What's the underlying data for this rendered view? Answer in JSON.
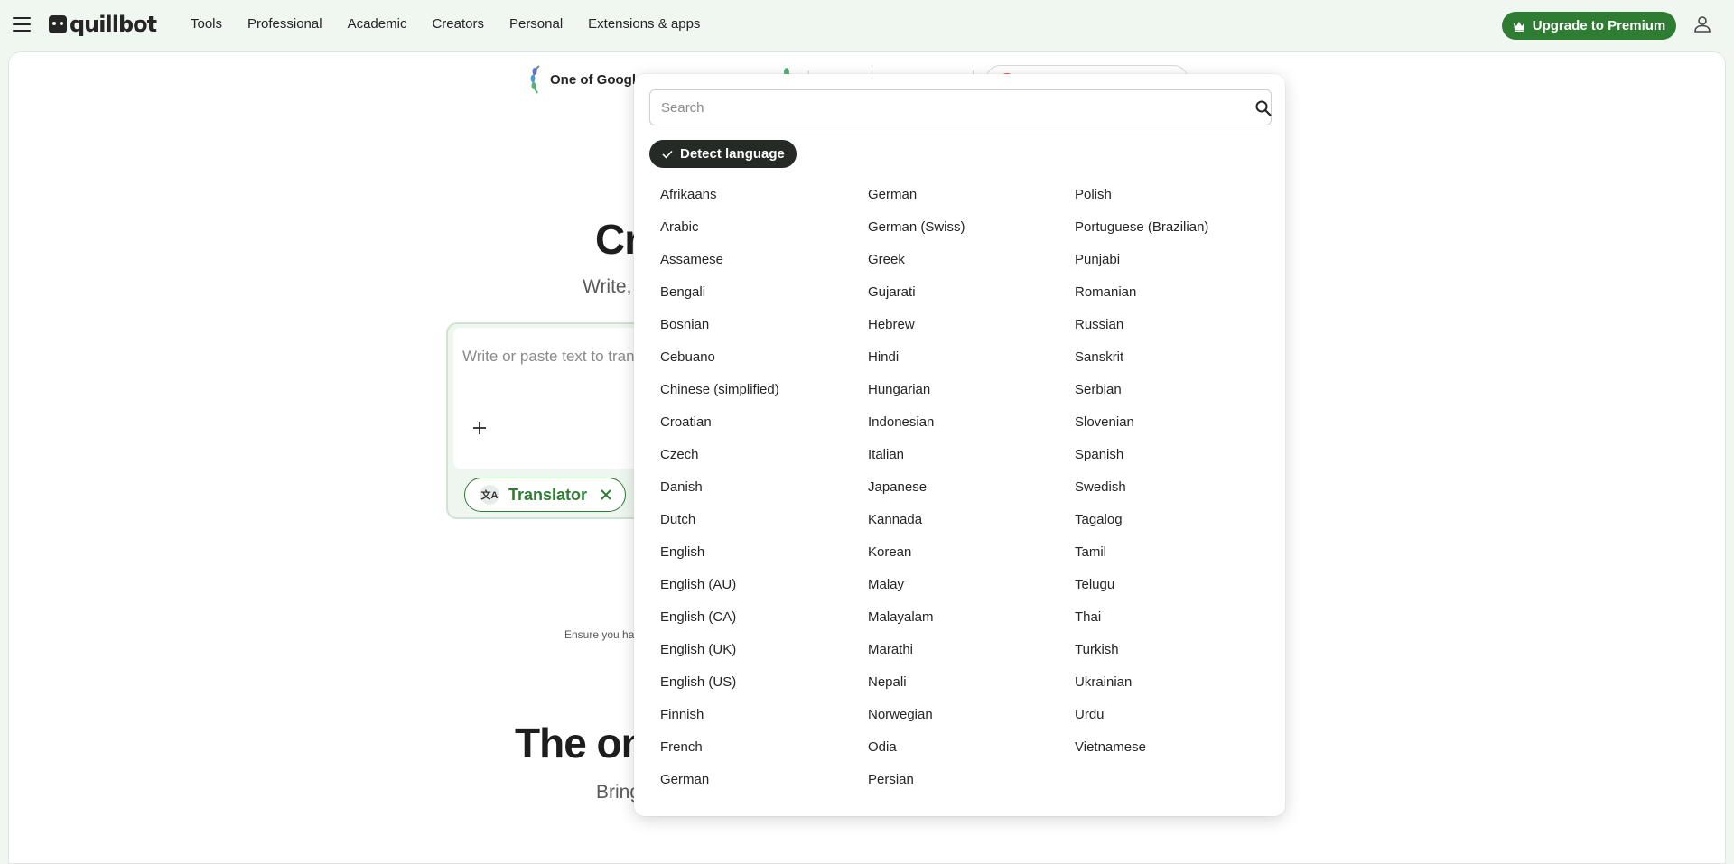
{
  "nav": {
    "logo_text": "quillbot",
    "links": [
      "Tools",
      "Professional",
      "Academic",
      "Creators",
      "Personal",
      "Extensions & apps"
    ],
    "upgrade_label": "Upgrade to Premium",
    "accent_color": "#2e7d32"
  },
  "hero": {
    "award_text": "One of Googl",
    "title": "Cr",
    "subtitle": "Write,",
    "placeholder": "Write or paste text to tran",
    "translator_label": "Translator",
    "translate_icon_text": "文A",
    "ensure_text": "Ensure you ha",
    "big_title": "The onl",
    "bring_text": "Bring"
  },
  "dropdown": {
    "search_placeholder": "Search",
    "detect_label": "Detect language",
    "columns": [
      [
        "Afrikaans",
        "Arabic",
        "Assamese",
        "Bengali",
        "Bosnian",
        "Cebuano",
        "Chinese (simplified)",
        "Croatian",
        "Czech",
        "Danish",
        "Dutch",
        "English",
        "English (AU)",
        "English (CA)",
        "English (UK)",
        "English (US)",
        "Finnish",
        "French",
        "German"
      ],
      [
        "German",
        "German (Swiss)",
        "Greek",
        "Gujarati",
        "Hebrew",
        "Hindi",
        "Hungarian",
        "Indonesian",
        "Italian",
        "Japanese",
        "Kannada",
        "Korean",
        "Malay",
        "Malayalam",
        "Marathi",
        "Nepali",
        "Norwegian",
        "Odia",
        "Persian"
      ],
      [
        "Polish",
        "Portuguese (Brazilian)",
        "Punjabi",
        "Romanian",
        "Russian",
        "Sanskrit",
        "Serbian",
        "Slovenian",
        "Spanish",
        "Swedish",
        "Tagalog",
        "Tamil",
        "Telugu",
        "Thai",
        "Turkish",
        "Ukrainian",
        "Urdu",
        "Vietnamese"
      ]
    ]
  }
}
